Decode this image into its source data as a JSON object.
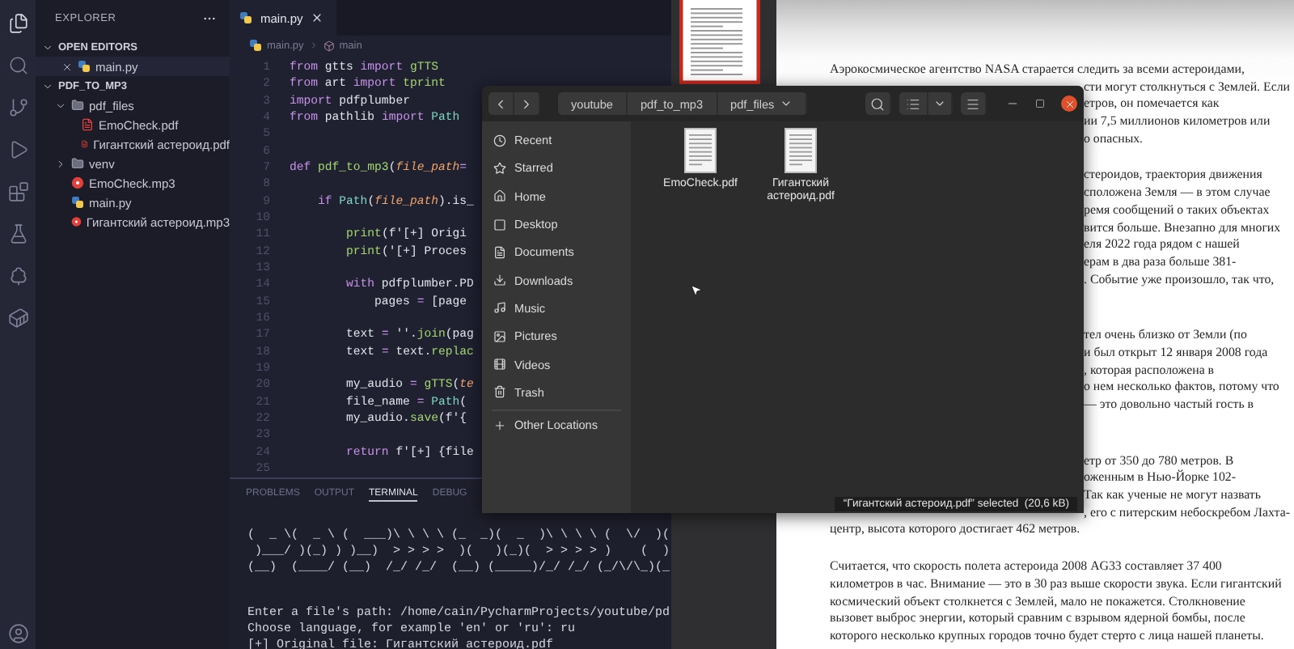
{
  "editor_window": {
    "explorer": {
      "title": "EXPLORER",
      "open_editors": {
        "title": "OPEN EDITORS",
        "expanded": true,
        "items": [
          {
            "name": "main.py",
            "kind": "py"
          }
        ]
      },
      "project": {
        "title": "PDF_TO_MP3",
        "expanded": true,
        "items": [
          {
            "name": "pdf_files",
            "kind": "folder",
            "expanded": true,
            "children": [
              {
                "name": "EmoCheck.pdf",
                "kind": "pdf"
              },
              {
                "name": "Гигантский астероид.pdf",
                "kind": "pdf"
              }
            ]
          },
          {
            "name": "venv",
            "kind": "folder",
            "expanded": false
          },
          {
            "name": "EmoCheck.mp3",
            "kind": "mp3"
          },
          {
            "name": "main.py",
            "kind": "py"
          },
          {
            "name": "Гигантский астероид.mp3",
            "kind": "mp3"
          }
        ]
      }
    },
    "tabs": [
      {
        "label": "main.py",
        "selected": true
      }
    ],
    "breadcrumb": [
      "main.py",
      "main"
    ],
    "code_lines": [
      {
        "number": "1",
        "tokens": [
          {
            "t": "from",
            "kind": "kw"
          },
          {
            "t": " gtts ",
            "kind": "plain"
          },
          {
            "t": "import",
            "kind": "kw"
          },
          {
            "t": " gTTS",
            "kind": "fn"
          }
        ]
      },
      {
        "number": "2",
        "tokens": [
          {
            "t": "from",
            "kind": "kw"
          },
          {
            "t": " art ",
            "kind": "plain"
          },
          {
            "t": "import",
            "kind": "kw"
          },
          {
            "t": " tprint",
            "kind": "fn"
          }
        ]
      },
      {
        "number": "3",
        "tokens": [
          {
            "t": "import",
            "kind": "kw"
          },
          {
            "t": " pdfplumber",
            "kind": "plain"
          }
        ]
      },
      {
        "number": "4",
        "tokens": [
          {
            "t": "from",
            "kind": "kw"
          },
          {
            "t": " pathlib ",
            "kind": "plain"
          },
          {
            "t": "import",
            "kind": "kw"
          },
          {
            "t": " Path",
            "kind": "cls"
          }
        ]
      },
      {
        "number": "5"
      },
      {
        "number": "6"
      },
      {
        "number": "7",
        "tokens": [
          {
            "t": "def",
            "kind": "kw"
          },
          {
            "t": " pdf_to_mp3",
            "kind": "fn"
          },
          {
            "t": "(",
            "kind": "plain"
          },
          {
            "t": "file_path",
            "kind": "param"
          },
          {
            "t": "=",
            "kind": "kw"
          }
        ]
      },
      {
        "number": "8"
      },
      {
        "number": "9",
        "tokens": [
          {
            "t": "    if",
            "kind": "kw"
          },
          {
            "t": " Path",
            "kind": "cls"
          },
          {
            "t": "(",
            "kind": "plain"
          },
          {
            "t": "file_path",
            "kind": "param"
          },
          {
            "t": ").is_",
            "kind": "plain"
          }
        ]
      },
      {
        "number": "10"
      },
      {
        "number": "11",
        "tokens": [
          {
            "t": "        print",
            "kind": "fn"
          },
          {
            "t": "(f'[+] Origi",
            "kind": "plain"
          }
        ]
      },
      {
        "number": "12",
        "tokens": [
          {
            "t": "        print",
            "kind": "fn"
          },
          {
            "t": "('[+] Proces",
            "kind": "plain"
          }
        ]
      },
      {
        "number": "13"
      },
      {
        "number": "14",
        "tokens": [
          {
            "t": "        with",
            "kind": "kw"
          },
          {
            "t": " pdfplumber.PD",
            "kind": "plain"
          }
        ]
      },
      {
        "number": "15",
        "tokens": [
          {
            "t": "            pages ",
            "kind": "plain"
          },
          {
            "t": "=",
            "kind": "kw"
          },
          {
            "t": " [page",
            "kind": "plain"
          }
        ]
      },
      {
        "number": "16"
      },
      {
        "number": "17",
        "tokens": [
          {
            "t": "        text ",
            "kind": "plain"
          },
          {
            "t": "=",
            "kind": "kw"
          },
          {
            "t": " ''.",
            "kind": "plain"
          },
          {
            "t": "join",
            "kind": "fn"
          },
          {
            "t": "(pag",
            "kind": "plain"
          }
        ]
      },
      {
        "number": "18",
        "tokens": [
          {
            "t": "        text ",
            "kind": "plain"
          },
          {
            "t": "=",
            "kind": "kw"
          },
          {
            "t": " text.",
            "kind": "plain"
          },
          {
            "t": "replac",
            "kind": "fn"
          }
        ]
      },
      {
        "number": "19"
      },
      {
        "number": "20",
        "tokens": [
          {
            "t": "        my_audio ",
            "kind": "plain"
          },
          {
            "t": "=",
            "kind": "kw"
          },
          {
            "t": " gTTS",
            "kind": "fn"
          },
          {
            "t": "(",
            "kind": "plain"
          },
          {
            "t": "te",
            "kind": "param"
          }
        ]
      },
      {
        "number": "21",
        "tokens": [
          {
            "t": "        file_name ",
            "kind": "plain"
          },
          {
            "t": "=",
            "kind": "kw"
          },
          {
            "t": " Path",
            "kind": "cls"
          },
          {
            "t": "(",
            "kind": "plain"
          }
        ]
      },
      {
        "number": "22",
        "tokens": [
          {
            "t": "        my_audio.",
            "kind": "plain"
          },
          {
            "t": "save",
            "kind": "fn"
          },
          {
            "t": "(f'{",
            "kind": "plain"
          }
        ]
      },
      {
        "number": "23"
      },
      {
        "number": "24",
        "tokens": [
          {
            "t": "        return",
            "kind": "kw"
          },
          {
            "t": " f'[+] {file",
            "kind": "plain"
          }
        ]
      },
      {
        "number": "25"
      }
    ],
    "panel": {
      "tabs": [
        {
          "label": "PROBLEMS",
          "selected": false
        },
        {
          "label": "OUTPUT",
          "selected": false
        },
        {
          "label": "TERMINAL",
          "selected": true
        },
        {
          "label": "DEBUG",
          "selected": false
        }
      ],
      "terminal_art": [
        "(  _ \\(  _ \\ (  ___)\\ \\ \\ \\ (_  _)(  _  )\\ \\ \\ \\ (  \\/  )(",
        " )___/ )(_) ) )__)  > > > >  )(   )(_)(  > > > > )    (  )",
        "(__)  (____/ (__)  /_/ /_/  (__) (_____)/_/ /_/ (_/\\/\\_)(_"
      ],
      "terminal_lines": [
        "Enter a file's path: /home/cain/PycharmProjects/youtube/pd",
        "Choose language, for example 'en' or 'ru': ru",
        "[+] Original file: Гигантский астероид.pdf"
      ]
    }
  },
  "document_viewer": {
    "paragraphs": [
      {
        "new_section": false,
        "lines": [
          {
            "text": "Аэрокосмическое агентство NASA старается следить за всеми астероидами,",
            "cut": false
          },
          {
            "text": "сти могут столкнуться с Землей. Если",
            "cut": true
          },
          {
            "text": "етров, он помечается как",
            "cut": true
          },
          {
            "text": "ии 7,5 миллионов километров или",
            "cut": true
          },
          {
            "text": "о опасных.",
            "cut": true
          }
        ]
      },
      {
        "new_section": false,
        "lines": [
          {
            "text": "стероидов, траектория движения",
            "cut": true
          },
          {
            "text": "сположена Земля — в этом случае",
            "cut": true
          },
          {
            "text": "ремя сообщений о таких объектах",
            "cut": true
          },
          {
            "text": "вится больше. Внезапно для многих",
            "cut": true
          },
          {
            "text": "еля 2022 года рядом с нашей",
            "cut": true
          },
          {
            "text": "ерам в два раза больше 381-",
            "cut": true
          },
          {
            "text": ". Событие уже произошло, так что,",
            "cut": true
          }
        ]
      },
      {
        "new_section": true,
        "lines": [
          {
            "text": "тел очень близко от Земли (по",
            "cut": true
          },
          {
            "text": "и был открыт 12 января 2008 года",
            "cut": true
          },
          {
            "text": ", которая расположена в",
            "cut": true
          },
          {
            "text": "о нем несколько фактов, потому что",
            "cut": true
          },
          {
            "text": "— это довольно частый гость в",
            "cut": true
          }
        ]
      },
      {
        "new_section": true,
        "lines": [
          {
            "text": "етр от 350 до 780 метров. В",
            "cut": true
          },
          {
            "text": "оженным в Нью-Йорке 102-",
            "cut": true
          },
          {
            "text": "Так как ученые не могут назвать",
            "cut": true
          },
          {
            "text": ", его с питерским небоскребом Лахта-",
            "cut": true
          },
          {
            "text": "центр, высота которого достигает 462 метров.",
            "cut": false
          }
        ]
      },
      {
        "new_section": false,
        "lines": [
          {
            "text": "Считается, что скорость полета астероида 2008 AG33 составляет 37 400",
            "cut": false
          },
          {
            "text": "километров в час. Внимание — это в 30 раз выше скорости звука. Если гигантский",
            "cut": false
          },
          {
            "text": "космический объект столкнется с Землей, мало не покажется. Столкновение",
            "cut": false
          },
          {
            "text": "вызовет выброс энергии, который сравним с взрывом ядерной бомбы, после",
            "cut": false
          },
          {
            "text": "которого несколько крупных городов точно будет стерто с лица нашей планеты.",
            "cut": false
          }
        ]
      }
    ]
  },
  "file_manager": {
    "path": [
      "youtube",
      "pdf_to_mp3",
      "pdf_files"
    ],
    "places": [
      {
        "label": "Recent",
        "kind": "recent"
      },
      {
        "label": "Starred",
        "kind": "starred"
      },
      {
        "label": "Home",
        "kind": "home"
      },
      {
        "label": "Desktop",
        "kind": "desktop"
      },
      {
        "label": "Documents",
        "kind": "documents"
      },
      {
        "label": "Downloads",
        "kind": "downloads"
      },
      {
        "label": "Music",
        "kind": "music"
      },
      {
        "label": "Pictures",
        "kind": "pictures"
      },
      {
        "label": "Videos",
        "kind": "videos"
      },
      {
        "label": "Trash",
        "kind": "trash"
      }
    ],
    "other_locations": "Other Locations",
    "files": [
      {
        "name": "EmoCheck.pdf"
      },
      {
        "name": "Гигантский астероид.pdf"
      }
    ],
    "status": "“Гигантский астероид.pdf” selected  (20,6 kB)"
  }
}
